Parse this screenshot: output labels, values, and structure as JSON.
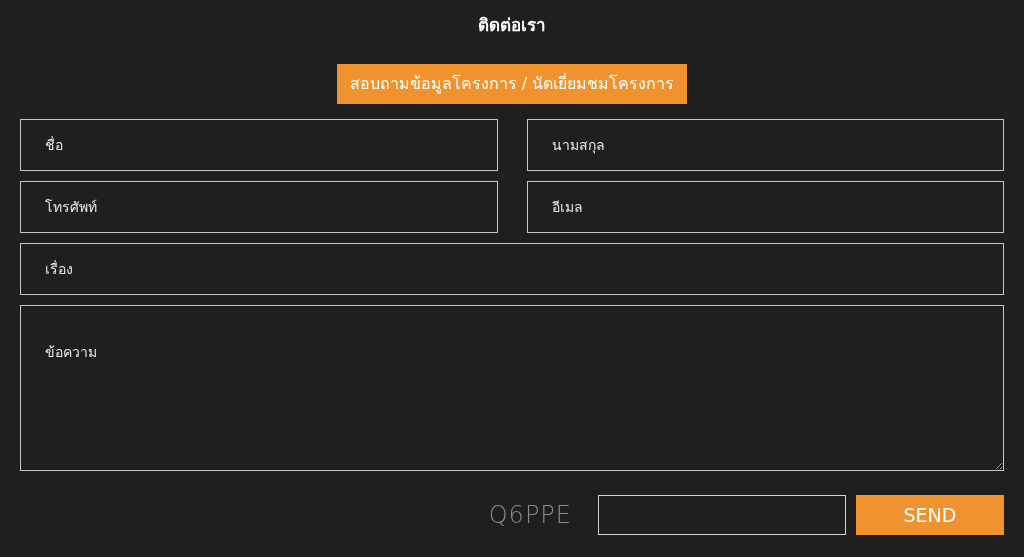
{
  "title": "ติดต่อเรา",
  "tab": {
    "label": "สอบถามข้อมูลโครงการ / นัดเยี่ยมชมโครงการ",
    "selected": true
  },
  "fields": [
    {
      "kind": "half",
      "placeholder": "ชื่อ"
    },
    {
      "kind": "half",
      "placeholder": "นามสกุล"
    },
    {
      "kind": "half",
      "placeholder": "โทรศัพท์"
    },
    {
      "kind": "half",
      "placeholder": "อีเมล"
    },
    {
      "kind": "full",
      "placeholder": "เรื่อง"
    },
    {
      "kind": "textarea",
      "placeholder": "ข้อความ"
    }
  ],
  "captcha": {
    "code": "Q6PPE"
  },
  "send_button": "SEND"
}
